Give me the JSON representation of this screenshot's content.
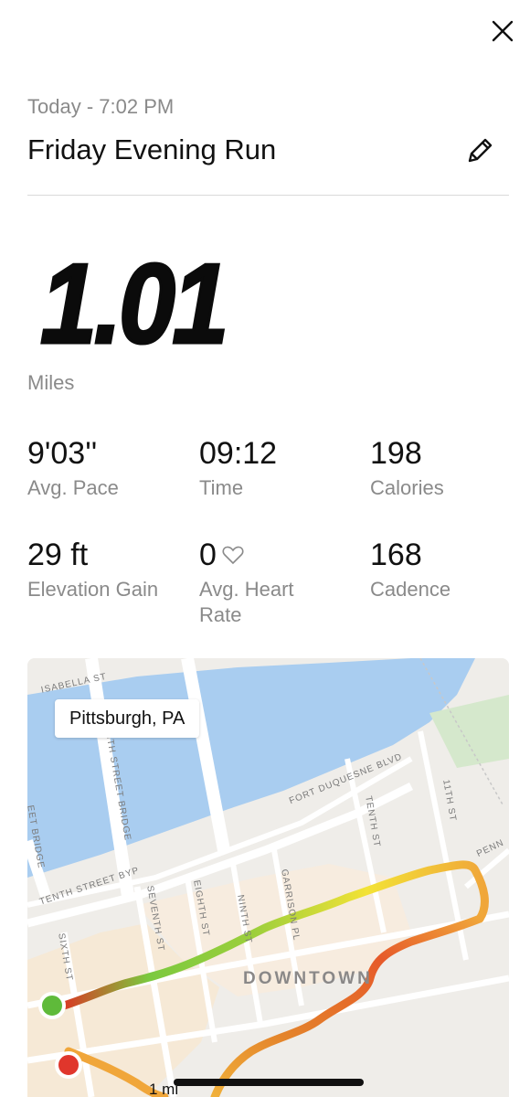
{
  "header": {
    "subtitle": "Today - 7:02 PM",
    "title": "Friday Evening Run"
  },
  "icons": {
    "close": "close-icon",
    "edit": "pencil-icon",
    "heart": "heart-outline-icon"
  },
  "summary": {
    "distance": "1.01",
    "distance_unit": "Miles"
  },
  "stats": [
    {
      "value": "9'03''",
      "label": "Avg. Pace"
    },
    {
      "value": "09:12",
      "label": "Time"
    },
    {
      "value": "198",
      "label": "Calories"
    },
    {
      "value": "29 ft",
      "label": "Elevation Gain"
    },
    {
      "value": "0",
      "label": "Avg. Heart Rate"
    },
    {
      "value": "168",
      "label": "Cadence"
    }
  ],
  "map": {
    "location_label": "Pittsburgh, PA",
    "area_label": "DOWNTOWN",
    "scale_label": "1 mi",
    "streets": [
      "ISABELLA ST",
      "FORT DUQUESNE BLVD",
      "TENTH ST",
      "TENTH STREET BYP",
      "SIXTH ST",
      "SEVENTH ST",
      "EIGHTH ST",
      "NINTH ST",
      "GARRISON PL",
      "NTH STREET BRIDGE",
      "EET BRIDGE",
      "11TH ST",
      "PENN"
    ],
    "colors": {
      "water": "#a9cdf0",
      "start": "#5fba3a",
      "end": "#e0362c"
    }
  }
}
